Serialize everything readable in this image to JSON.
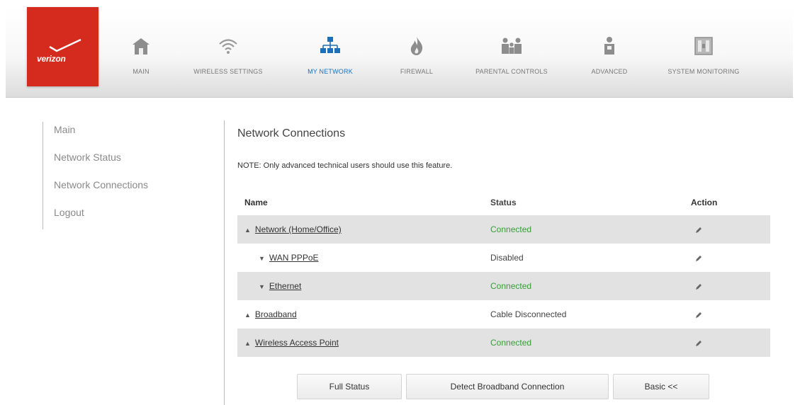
{
  "brand": {
    "logo_text": "verizon",
    "color": "#d52b1e"
  },
  "nav": {
    "items": [
      {
        "label": "MAIN",
        "icon": "home-icon"
      },
      {
        "label": "WIRELESS SETTINGS",
        "icon": "wifi-icon"
      },
      {
        "label": "MY NETWORK",
        "icon": "network-icon",
        "active": true
      },
      {
        "label": "FIREWALL",
        "icon": "flame-icon"
      },
      {
        "label": "PARENTAL CONTROLS",
        "icon": "family-icon"
      },
      {
        "label": "ADVANCED",
        "icon": "user-settings-icon"
      },
      {
        "label": "SYSTEM MONITORING",
        "icon": "monitor-icon"
      }
    ],
    "active_color": "#1d6fb8"
  },
  "sidebar": {
    "items": [
      {
        "label": "Main"
      },
      {
        "label": "Network Status"
      },
      {
        "label": "Network Connections"
      },
      {
        "label": "Logout"
      }
    ]
  },
  "main": {
    "title": "Network Connections",
    "note": "NOTE: Only advanced technical users should use this feature.",
    "table": {
      "headers": {
        "name": "Name",
        "status": "Status",
        "action": "Action"
      },
      "rows": [
        {
          "name": "Network (Home/Office)",
          "status": "Connected",
          "expander": "expanded"
        },
        {
          "name": "WAN PPPoE",
          "status": "Disabled",
          "expander": "collapsed"
        },
        {
          "name": "Ethernet",
          "status": "Connected",
          "expander": "collapsed"
        },
        {
          "name": "Broadband",
          "status": "Cable Disconnected",
          "expander": "expanded"
        },
        {
          "name": "Wireless Access Point",
          "status": "Connected",
          "expander": "expanded"
        }
      ],
      "connected_color": "#3a9a3a"
    },
    "buttons": {
      "full_status": "Full Status",
      "detect": "Detect Broadband Connection",
      "basic": "Basic <<"
    }
  }
}
